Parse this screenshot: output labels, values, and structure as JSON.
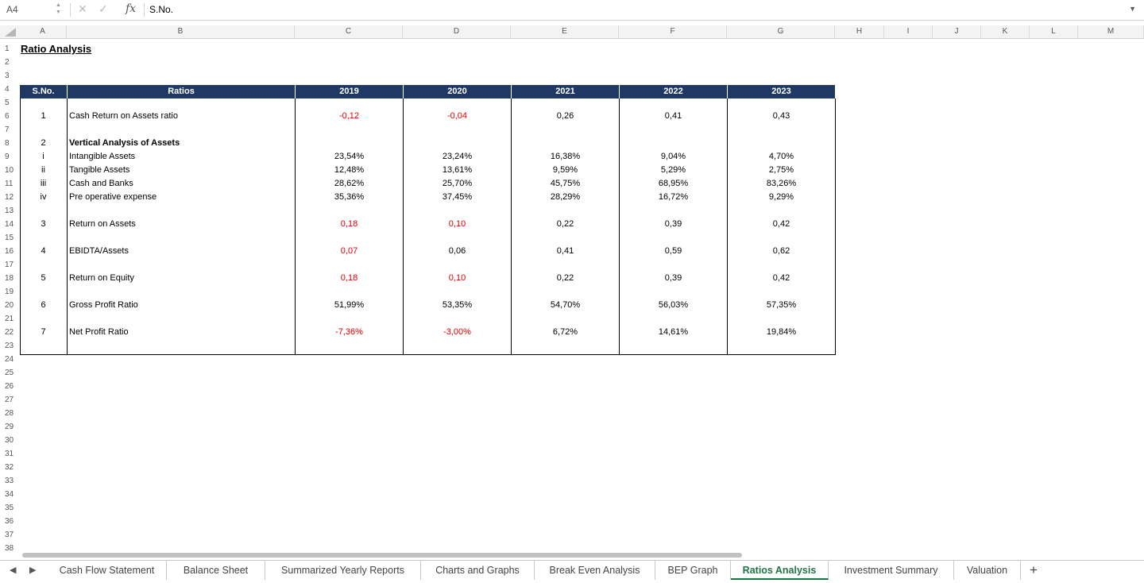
{
  "formula_bar": {
    "cell_ref": "A4",
    "formula": "S.No.",
    "fx": "fx"
  },
  "columns": [
    "A",
    "B",
    "C",
    "D",
    "E",
    "F",
    "G",
    "H",
    "I",
    "J",
    "K",
    "L",
    "M"
  ],
  "rows": [
    "1",
    "2",
    "3",
    "4",
    "5",
    "6",
    "7",
    "8",
    "9",
    "10",
    "11",
    "12",
    "13",
    "14",
    "15",
    "16",
    "17",
    "18",
    "19",
    "20",
    "21",
    "22",
    "23",
    "24",
    "25",
    "26",
    "27",
    "28",
    "29",
    "30",
    "31",
    "32",
    "33",
    "34",
    "35",
    "36",
    "37",
    "38"
  ],
  "sheet_title": "Ratio Analysis",
  "table_header": {
    "sno": "S.No.",
    "ratios": "Ratios",
    "years": [
      "2019",
      "2020",
      "2021",
      "2022",
      "2023"
    ]
  },
  "table_rows": [
    {
      "row": 6,
      "sno": "1",
      "label": "Cash Return on Assets ratio",
      "bold": false,
      "values": [
        "-0,12",
        "-0,04",
        "0,26",
        "0,41",
        "0,43"
      ],
      "red": [
        true,
        true,
        false,
        false,
        false
      ]
    },
    {
      "row": 8,
      "sno": "2",
      "label": "Vertical Analysis of Assets",
      "bold": true,
      "values": [
        "",
        "",
        "",
        "",
        ""
      ],
      "red": [
        false,
        false,
        false,
        false,
        false
      ]
    },
    {
      "row": 9,
      "sno": "i",
      "label": "Intangible Assets",
      "bold": false,
      "values": [
        "23,54%",
        "23,24%",
        "16,38%",
        "9,04%",
        "4,70%"
      ],
      "red": [
        false,
        false,
        false,
        false,
        false
      ]
    },
    {
      "row": 10,
      "sno": "ii",
      "label": "Tangible Assets",
      "bold": false,
      "values": [
        "12,48%",
        "13,61%",
        "9,59%",
        "5,29%",
        "2,75%"
      ],
      "red": [
        false,
        false,
        false,
        false,
        false
      ]
    },
    {
      "row": 11,
      "sno": "iii",
      "label": "Cash and Banks",
      "bold": false,
      "values": [
        "28,62%",
        "25,70%",
        "45,75%",
        "68,95%",
        "83,26%"
      ],
      "red": [
        false,
        false,
        false,
        false,
        false
      ]
    },
    {
      "row": 12,
      "sno": "iv",
      "label": "Pre operative expense",
      "bold": false,
      "values": [
        "35,36%",
        "37,45%",
        "28,29%",
        "16,72%",
        "9,29%"
      ],
      "red": [
        false,
        false,
        false,
        false,
        false
      ]
    },
    {
      "row": 14,
      "sno": "3",
      "label": "Return on Assets",
      "bold": false,
      "values": [
        "0,18",
        "0,10",
        "0,22",
        "0,39",
        "0,42"
      ],
      "red": [
        true,
        true,
        false,
        false,
        false
      ]
    },
    {
      "row": 16,
      "sno": "4",
      "label": "EBIDTA/Assets",
      "bold": false,
      "values": [
        "0,07",
        "0,06",
        "0,41",
        "0,59",
        "0,62"
      ],
      "red": [
        true,
        false,
        false,
        false,
        false
      ]
    },
    {
      "row": 18,
      "sno": "5",
      "label": "Return on Equity",
      "bold": false,
      "values": [
        "0,18",
        "0,10",
        "0,22",
        "0,39",
        "0,42"
      ],
      "red": [
        true,
        true,
        false,
        false,
        false
      ]
    },
    {
      "row": 20,
      "sno": "6",
      "label": "Gross Profit Ratio",
      "bold": false,
      "values": [
        "51,99%",
        "53,35%",
        "54,70%",
        "56,03%",
        "57,35%"
      ],
      "red": [
        false,
        false,
        false,
        false,
        false
      ]
    },
    {
      "row": 22,
      "sno": "7",
      "label": "Net Profit Ratio",
      "bold": false,
      "values": [
        "-7,36%",
        "-3,00%",
        "6,72%",
        "14,61%",
        "19,84%"
      ],
      "red": [
        true,
        true,
        false,
        false,
        false
      ]
    }
  ],
  "tabs": [
    {
      "label": "Cash Flow Statement",
      "active": false
    },
    {
      "label": "Balance Sheet",
      "active": false
    },
    {
      "label": "Summarized Yearly Reports",
      "active": false
    },
    {
      "label": "Charts and Graphs",
      "active": false
    },
    {
      "label": "Break Even Analysis",
      "active": false
    },
    {
      "label": "BEP Graph",
      "active": false
    },
    {
      "label": "Ratios Analysis",
      "active": true
    },
    {
      "label": "Investment Summary",
      "active": false
    },
    {
      "label": "Valuation",
      "active": false
    }
  ],
  "colors": {
    "header_band": "#1f3864",
    "negative": "#e00000",
    "active_tab": "#217346"
  },
  "icons": [
    "x-icon",
    "check-icon",
    "fx-icon",
    "chevron-down-icon",
    "prev-sheet-icon",
    "next-sheet-icon",
    "add-sheet-icon"
  ]
}
